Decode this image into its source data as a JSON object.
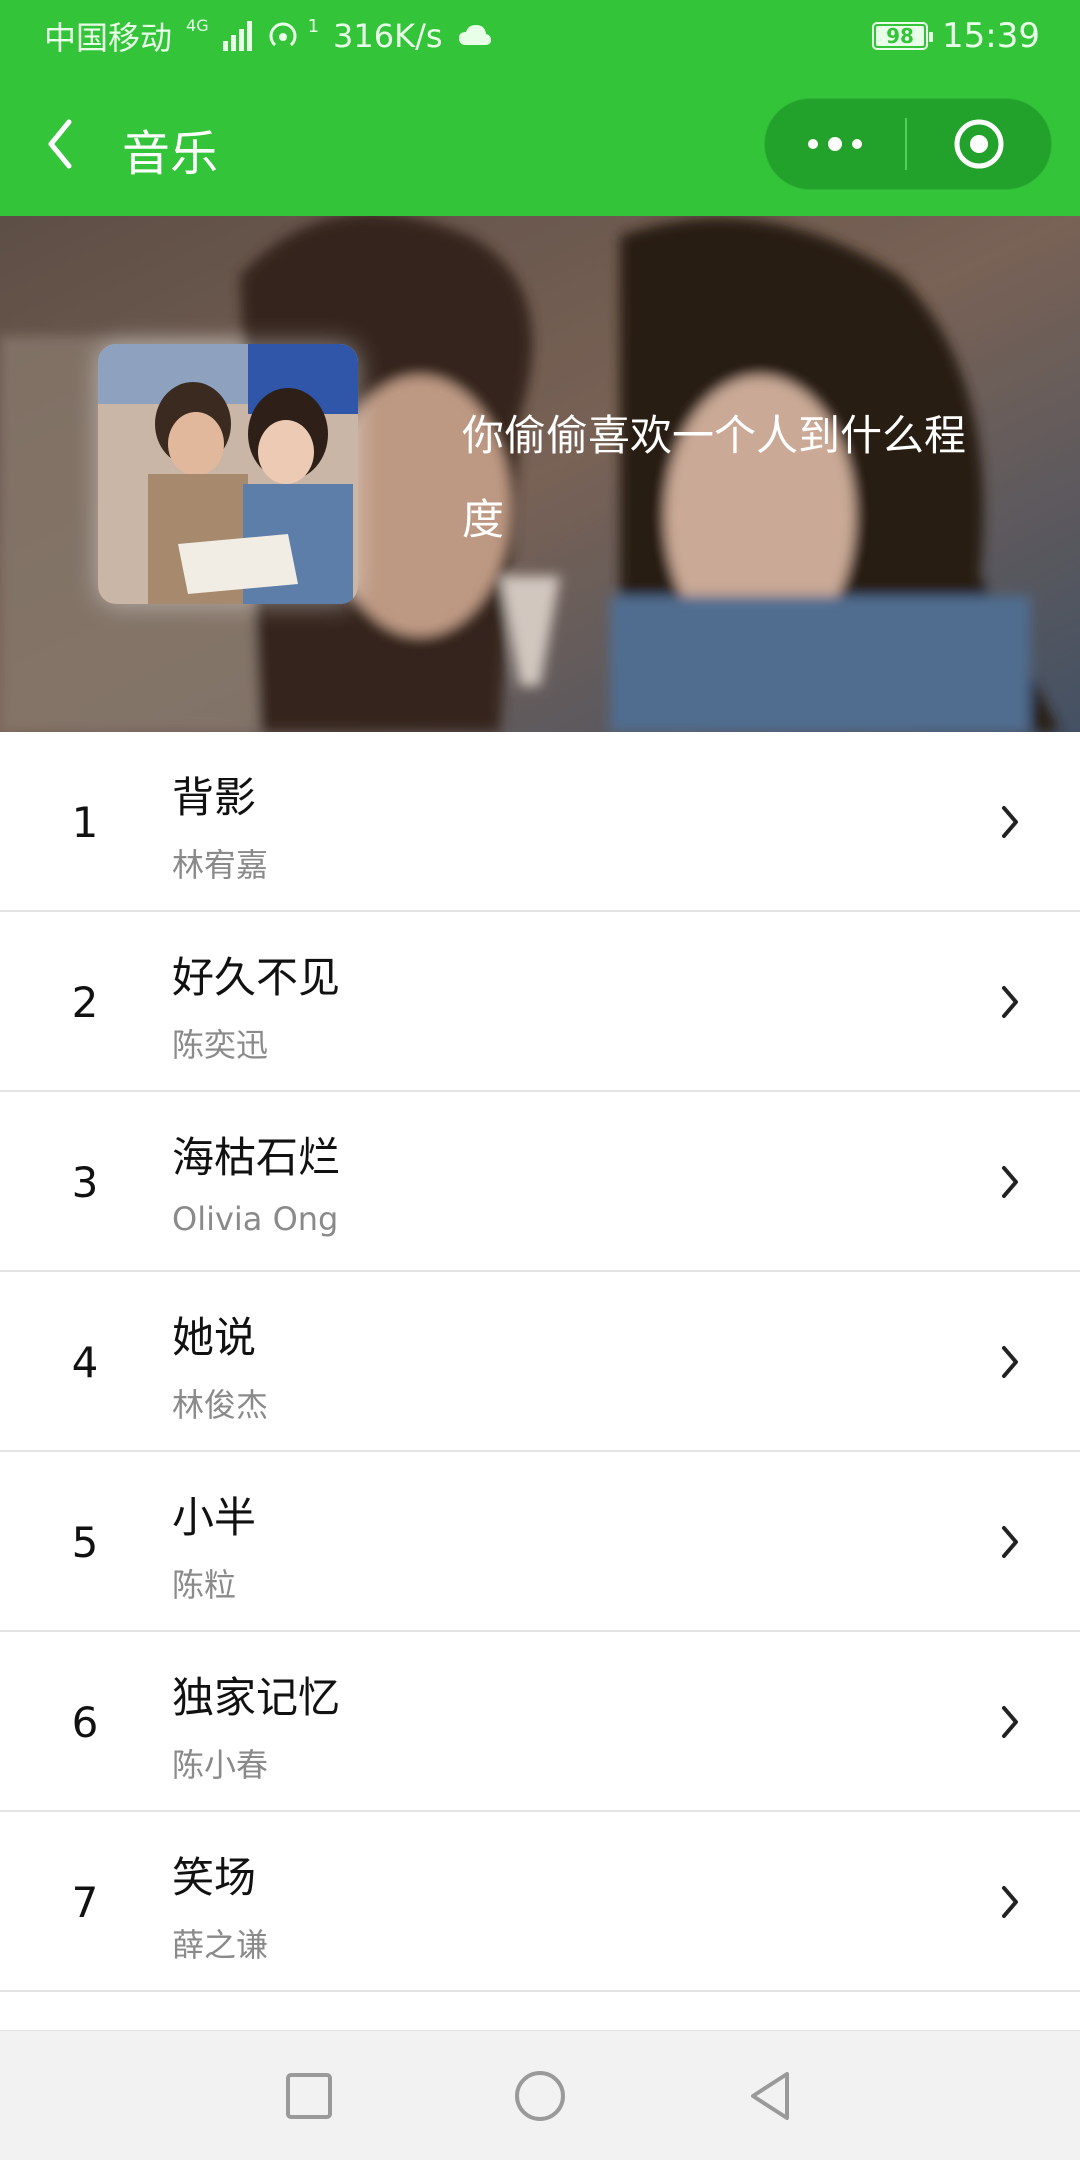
{
  "status_bar": {
    "carrier": "中国移动",
    "network_type": "4G",
    "hotspot_count": "1",
    "speed": "316K/s",
    "battery": "98",
    "time": "15:39"
  },
  "nav": {
    "title": "音乐",
    "back_icon": "chevron-left-icon",
    "more_icon": "more-dots-icon",
    "close_icon": "target-circle-icon",
    "bar_color": "#33c43a"
  },
  "playlist": {
    "title": "你偷偷喜欢一个人到什么程度"
  },
  "songs": [
    {
      "index": "1",
      "name": "背影",
      "artist": "林宥嘉"
    },
    {
      "index": "2",
      "name": "好久不见",
      "artist": "陈奕迅"
    },
    {
      "index": "3",
      "name": "海枯石烂",
      "artist": "Olivia Ong"
    },
    {
      "index": "4",
      "name": "她说",
      "artist": "林俊杰"
    },
    {
      "index": "5",
      "name": "小半",
      "artist": "陈粒"
    },
    {
      "index": "6",
      "name": "独家记忆",
      "artist": "陈小春"
    },
    {
      "index": "7",
      "name": "笑场",
      "artist": "薛之谦"
    }
  ],
  "bottom_nav": {
    "recents_icon": "square-icon",
    "home_icon": "circle-icon",
    "back_icon": "triangle-back-icon"
  }
}
